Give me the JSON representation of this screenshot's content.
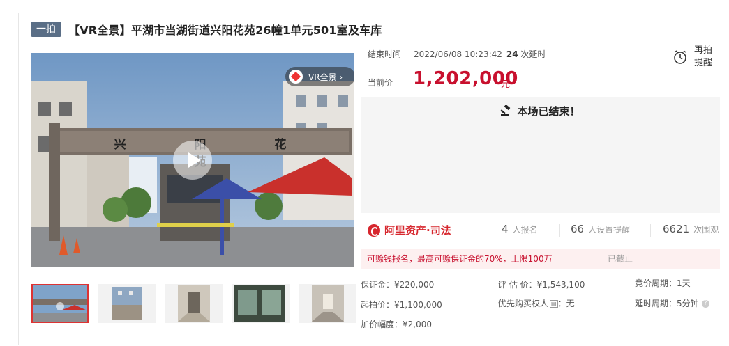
{
  "header": {
    "badge": "一拍",
    "title": "【VR全景】平湖市当湖街道兴阳花苑26幢1单元501室及车库"
  },
  "gallery": {
    "vr_tag": "VR全景 ›",
    "gate_sign": "兴 阳 花 苑",
    "thumbnails": [
      "thumb-1",
      "thumb-2",
      "thumb-3",
      "thumb-4",
      "thumb-5"
    ]
  },
  "auction": {
    "end_time_label": "结束时间",
    "end_time_value": "2022/06/08 10:23:42",
    "delay_count": "24",
    "delay_suffix": "次延时",
    "price_label": "当前价",
    "price_value": "1,202,000",
    "price_unit": "元",
    "remind_label": "再拍提醒",
    "ended_text": "本场已结束！"
  },
  "stats": {
    "brand": "阿里资产·司法",
    "signup_count": "4",
    "signup_label": "人报名",
    "reminder_count": "66",
    "reminder_label": "人设置提醒",
    "view_count": "6621",
    "view_label": "次围观"
  },
  "notice": {
    "text": "可赊钱报名，最高可赊保证金的70%，上限100万",
    "status": "已截止"
  },
  "details": {
    "deposit": "保证金：¥220,000",
    "appraisal": "评 估 价：¥1,543,100",
    "bid_period": "竞价周期：1天",
    "start_price": "起拍价：¥1,100,000",
    "priority_buyer_label": "优先购买权人",
    "priority_buyer_value": "：无",
    "delay_period": "延时周期：5分钟",
    "increment": "加价幅度：¥2,000"
  },
  "colors": {
    "accent": "#c8102e",
    "badge_bg": "#5a6e86",
    "panel_bg": "#f5f5f5",
    "notice_bg": "#fdf0f0"
  }
}
